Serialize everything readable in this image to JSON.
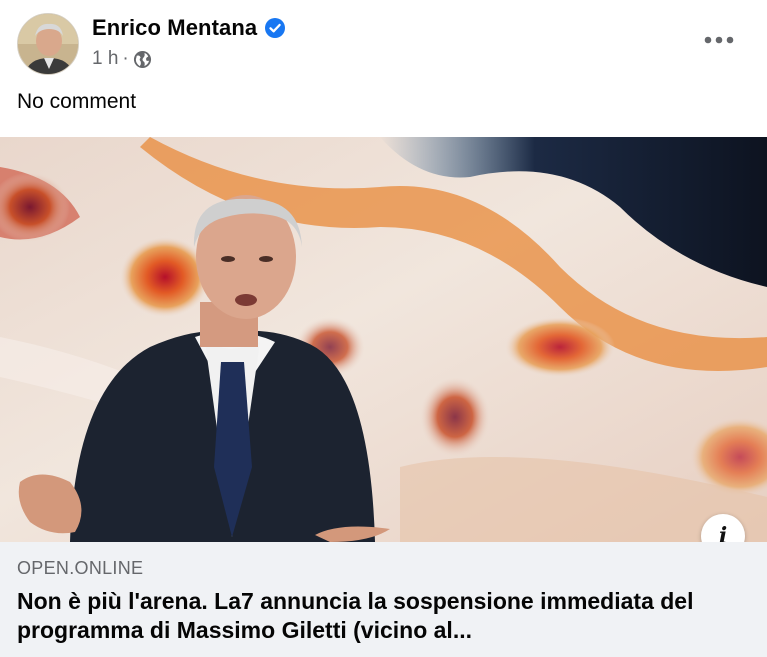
{
  "post": {
    "author": "Enrico Mentana",
    "time": "1 h",
    "separator": "·",
    "audience_icon": "globe-icon",
    "verified_icon": "verified-badge-icon",
    "more_icon": "more-options-icon",
    "text": "No comment"
  },
  "link_preview": {
    "image_description": "man-in-suit-shrugging",
    "info_icon": "info-icon",
    "info_label": "i",
    "domain": "OPEN.ONLINE",
    "headline": "Non è più l'arena. La7 annuncia la sospensione immediata del programma di Massimo Giletti (vicino al..."
  },
  "colors": {
    "verified_blue": "#1877f2",
    "secondary_text": "#65676b",
    "link_footer_bg": "#f0f2f5"
  }
}
